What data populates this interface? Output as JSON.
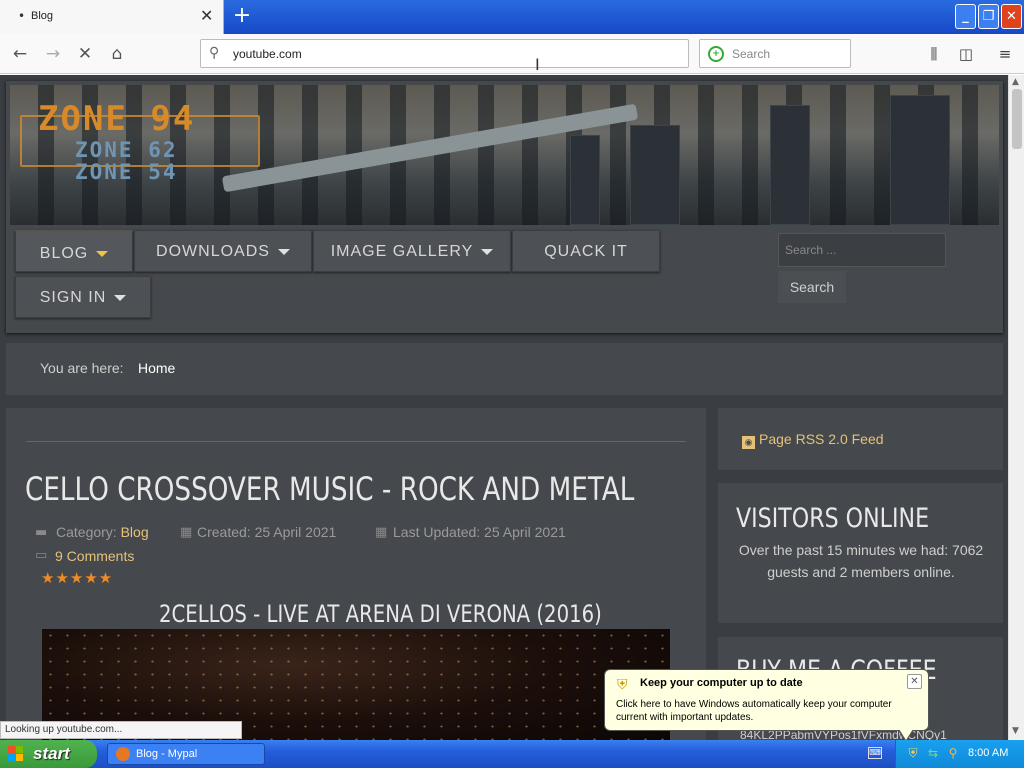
{
  "browser": {
    "tab_title": "Blog",
    "new_tab_symbol": "+",
    "url": "youtube.com",
    "search_placeholder": "Search",
    "status_text": "Looking up youtube.com..."
  },
  "site": {
    "logo_main": "ZONE 94",
    "logo_sub1": "ZONE 62",
    "logo_sub2": "ZONE 54",
    "menu": [
      {
        "label": "BLOG",
        "has_dropdown": true,
        "active": true
      },
      {
        "label": "DOWNLOADS",
        "has_dropdown": true
      },
      {
        "label": "IMAGE GALLERY",
        "has_dropdown": true
      },
      {
        "label": "QUACK IT",
        "has_dropdown": false
      },
      {
        "label": "SIGN IN",
        "has_dropdown": true
      }
    ],
    "search_placeholder": "Search ...",
    "search_button": "Search",
    "breadcrumb_label": "You are here:",
    "breadcrumb_home": "Home"
  },
  "article": {
    "title": "CELLO CROSSOVER MUSIC - ROCK AND METAL",
    "category_label": "Category:",
    "category": "Blog",
    "created": "Created: 25 April 2021",
    "updated": "Last Updated: 25 April 2021",
    "comments": "9 Comments",
    "rating_stars": "★★★★★",
    "video_title": "2CELLOS - LIVE AT ARENA DI VERONA (2016)"
  },
  "sidebar": {
    "rss": "Page RSS 2.0 Feed",
    "visitors_title": "VISITORS ONLINE",
    "visitors_text": "Over the past 15 minutes we had: 7062 guests and 2 members online.",
    "coffee_title": "BUY ME A COFFEE",
    "coffee_code": "84KL2PPabmVYPos1fVFxmdwCNQy1"
  },
  "notification": {
    "title": "Keep your computer up to date",
    "text": "Click here to have Windows automatically keep your computer current with important updates."
  },
  "taskbar": {
    "start_label": "start",
    "task_label": "Blog - Mypal",
    "clock": "8:00 AM"
  },
  "colors": {
    "accent_link": "#e5c27a",
    "star": "#f08a24",
    "page_bg": "#3a3d41"
  }
}
